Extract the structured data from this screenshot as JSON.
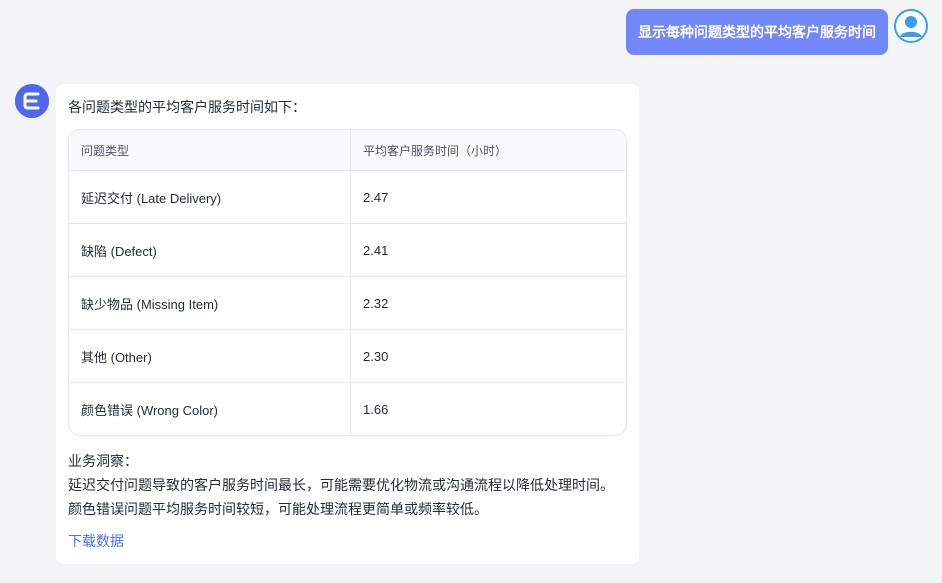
{
  "user_message": {
    "text": "显示每种问题类型的平均客户服务时间"
  },
  "bot_message": {
    "intro": "各问题类型的平均客户服务时间如下：",
    "table": {
      "headers": [
        "问题类型",
        "平均客户服务时间（小时）"
      ],
      "rows": [
        [
          "延迟交付 (Late Delivery)",
          "2.47"
        ],
        [
          "缺陷 (Defect)",
          "2.41"
        ],
        [
          "缺少物品 (Missing Item)",
          "2.32"
        ],
        [
          "其他 (Other)",
          "2.30"
        ],
        [
          "颜色错误 (Wrong Color)",
          "1.66"
        ]
      ]
    },
    "insights_title": "业务洞察：",
    "insights": [
      "延迟交付问题导致的客户服务时间最长，可能需要优化物流或沟通流程以降低处理时间。",
      "颜色错误问题平均服务时间较短，可能处理流程更简单或频率较低。"
    ],
    "download_label": "下载数据"
  },
  "colors": {
    "user_bubble": "#7287f8",
    "bot_avatar": "#4f66ee",
    "link": "#4f6ef0",
    "page_bg": "#f3f4f6"
  },
  "icons": {
    "user_avatar": "user-avatar-icon",
    "bot_avatar": "bot-logo-icon"
  }
}
